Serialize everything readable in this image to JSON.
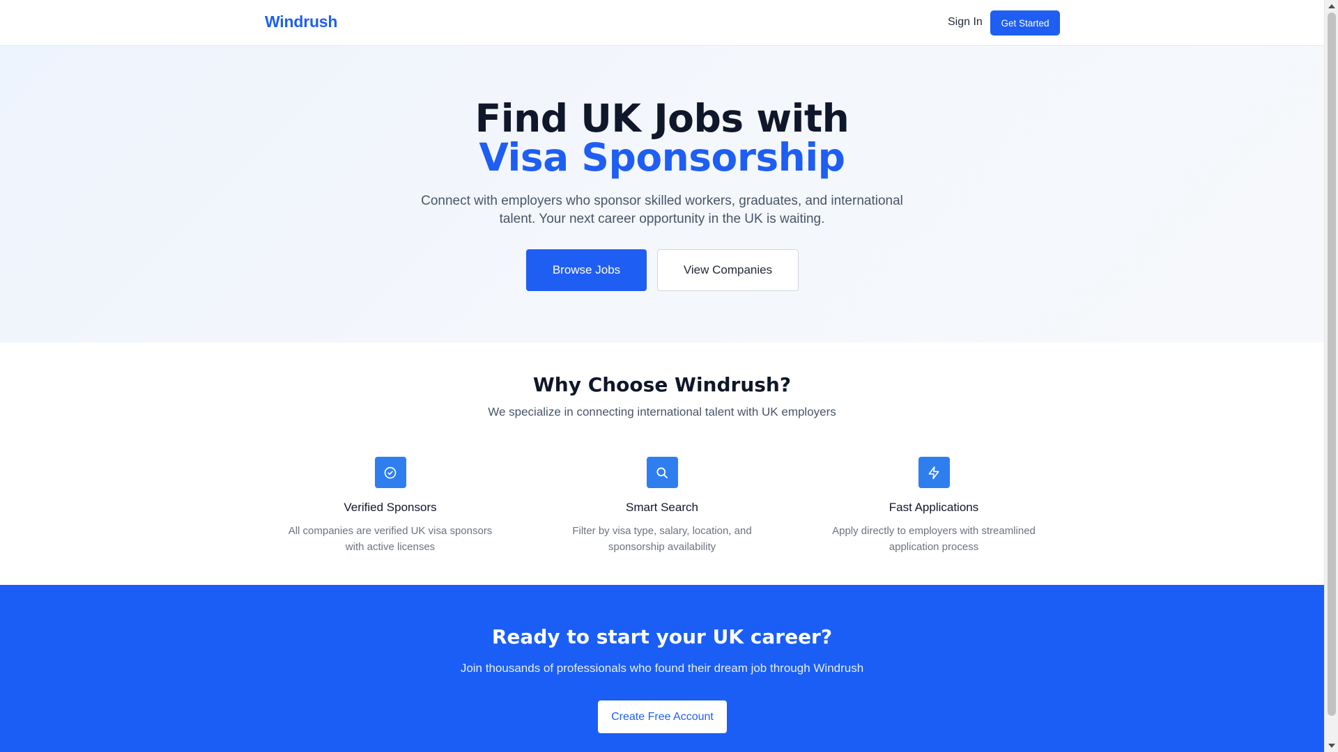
{
  "header": {
    "logo": "Windrush",
    "signin_label": "Sign In",
    "get_started_label": "Get Started"
  },
  "hero": {
    "title_line1": "Find UK Jobs with",
    "title_line2": "Visa Sponsorship",
    "subtitle": "Connect with employers who sponsor skilled workers, graduates, and international talent. Your next career opportunity in the UK is waiting.",
    "browse_label": "Browse Jobs",
    "companies_label": "View Companies"
  },
  "features": {
    "title": "Why Choose Windrush?",
    "subtitle": "We specialize in connecting international talent with UK employers",
    "items": [
      {
        "icon": "check-circle-icon",
        "title": "Verified Sponsors",
        "desc": "All companies are verified UK visa sponsors with active licenses"
      },
      {
        "icon": "search-icon",
        "title": "Smart Search",
        "desc": "Filter by visa type, salary, location, and sponsorship availability"
      },
      {
        "icon": "lightning-icon",
        "title": "Fast Applications",
        "desc": "Apply directly to employers with streamlined application process"
      }
    ]
  },
  "cta": {
    "title": "Ready to start your UK career?",
    "subtitle": "Join thousands of professionals who found their dream job through Windrush",
    "button_label": "Create Free Account"
  },
  "colors": {
    "brand": "#1e5ef2",
    "cta_bg": "#1a5ef6",
    "icon_bg": "#2f7ef0"
  }
}
